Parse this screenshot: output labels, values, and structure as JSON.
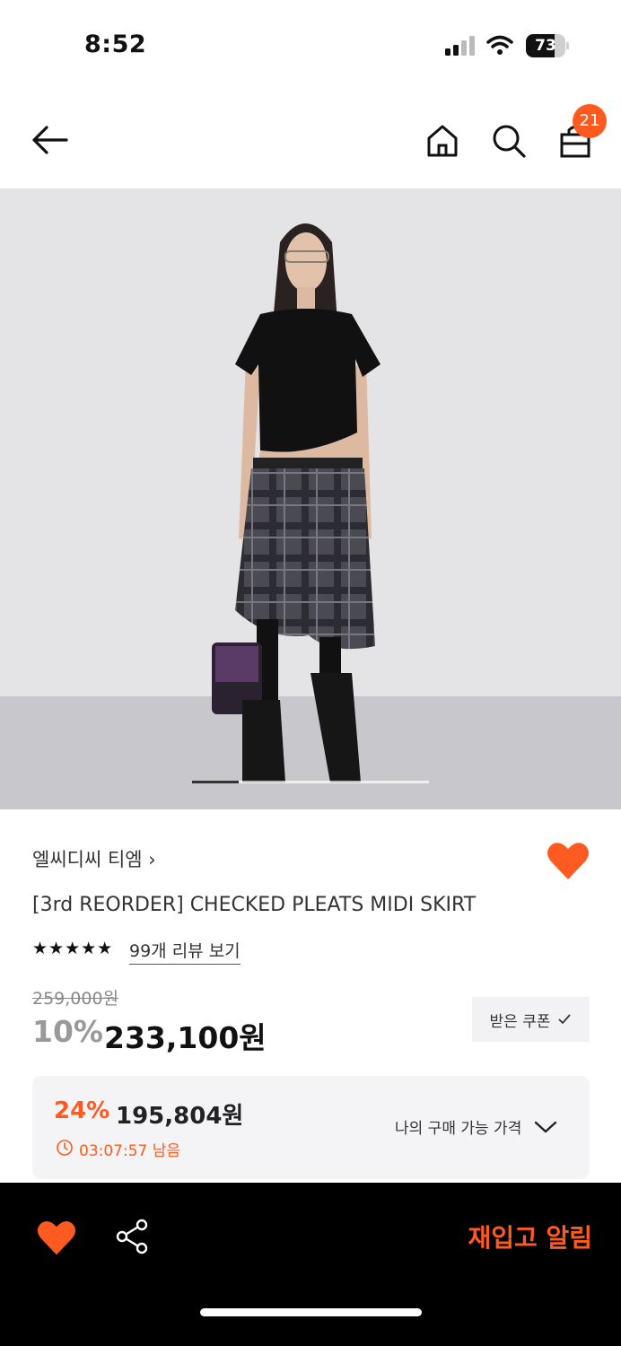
{
  "status_bar": {
    "time": "8:52",
    "battery_level": "73",
    "battery_fraction": 0.73,
    "icons": [
      "signal-icon",
      "wifi-icon",
      "battery-icon"
    ]
  },
  "header": {
    "cart_count": "21",
    "icons": [
      "back-arrow-icon",
      "home-icon",
      "search-icon",
      "shopping-bag-icon"
    ]
  },
  "gallery": {
    "current_image": 1
  },
  "product": {
    "brand": "엘씨디씨 티엠",
    "brand_chevron": "›",
    "title": "[3rd REORDER] CHECKED PLEATS MIDI SKIRT",
    "rating_stars": "★★★★★",
    "rating": 5,
    "review_link": "99개 리뷰 보기",
    "original_price": "259,000원",
    "discount_rate": "10%",
    "sale_price": "233,100원",
    "coupon_label": "받은 쿠폰",
    "liked": true
  },
  "member_price": {
    "rate": "24%",
    "price": "195,804원",
    "timer": "03:07:57 남음",
    "dropdown_label": "나의 구매 가능 가격"
  },
  "bottom_bar": {
    "restock_label": "재입고 알림",
    "icons": [
      "heart-icon",
      "share-icon"
    ]
  },
  "colors": {
    "accent": "#ff5a1f",
    "bottom_bar_bg": "#000000"
  }
}
